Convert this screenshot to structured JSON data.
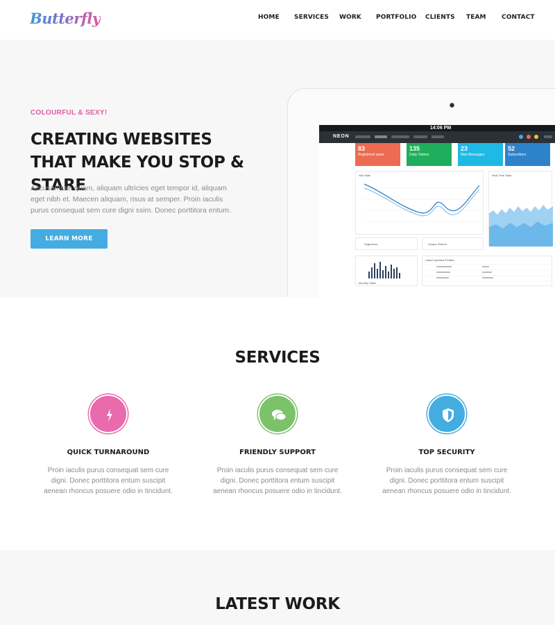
{
  "brand": {
    "logo_text": "Butterfly"
  },
  "nav": {
    "items": [
      "HOME",
      "SERVICES",
      "WORK",
      "PORTFOLIO",
      "CLIENTS",
      "TEAM",
      "CONTACT"
    ]
  },
  "hero": {
    "eyebrow": "COLOURFUL & SEXY!",
    "title": "CREATING WEBSITES THAT MAKE YOU STOP & STARE",
    "text": "Accusantium quam, aliquam ultricies eget tempor id, aliquam eget nibh et. Maecen aliquam, risus at semper. Proin iaculis purus consequat sem cure digni ssim. Donec porttitora entum.",
    "button_label": "LEARN MORE"
  },
  "device": {
    "status_time": "14:06 PM",
    "app_name": "NEON",
    "stats": [
      {
        "value": "83",
        "label": "Registered users",
        "color": "#ec6b52"
      },
      {
        "value": "135",
        "label": "Daily Visitors",
        "color": "#1fae5c"
      },
      {
        "value": "23",
        "label": "New Messages",
        "color": "#1fb9e6"
      },
      {
        "value": "52",
        "label": "Subscribers",
        "color": "#2d82c9"
      }
    ],
    "site_stats_label": "Site Stats",
    "realtime_label": "Real Time Stats",
    "pageviews_label": "Pageviews",
    "unique_visitors_label": "Unique Visitors",
    "monthly_sales_label": "Monthly Sales",
    "latest_profiles_label": "Latest Updated Profiles"
  },
  "services": {
    "title": "SERVICES",
    "items": [
      {
        "title": "QUICK TURNAROUND",
        "icon": "lightning-icon",
        "color": "#e96aad",
        "text": "Proin iaculis purus consequat sem cure digni. Donec porttitora entum suscipit aenean rhoncus posuere odio in tincidunt."
      },
      {
        "title": "FRIENDLY SUPPORT",
        "icon": "chat-icon",
        "color": "#7cc26a",
        "text": "Proin iaculis purus consequat sem cure digni. Donec porttitora entum suscipit aenean rhoncus posuere odio in tincidunt."
      },
      {
        "title": "TOP SECURITY",
        "icon": "shield-icon",
        "color": "#44ace0",
        "text": "Proin iaculis purus consequat sem cure digni. Donec porttitora entum suscipit aenean rhoncus posuere odio in tincidunt."
      }
    ]
  },
  "latest_work": {
    "title": "LATEST WORK"
  }
}
